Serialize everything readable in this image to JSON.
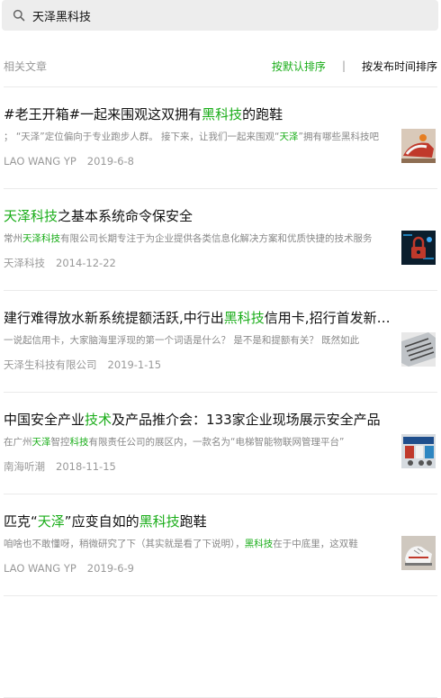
{
  "search": {
    "query": "天泽黑科技",
    "icon": "search-icon"
  },
  "section": {
    "label": "相关文章"
  },
  "sort": {
    "default_label": "按默认排序",
    "separator": "|",
    "time_label": "按发布时间排序"
  },
  "colors": {
    "highlight": "#1aad19",
    "muted": "#999999",
    "search_bg": "#ededed"
  },
  "results": [
    {
      "title": [
        {
          "t": "#老王开箱#一起来围观这双拥有"
        },
        {
          "t": "黑科技",
          "hl": true
        },
        {
          "t": "的跑鞋"
        }
      ],
      "snippet": [
        {
          "t": "；  “天泽”定位偏向于专业跑步人群。 接下来，让我们一起来围观“"
        },
        {
          "t": "天泽",
          "hl": true
        },
        {
          "t": "”拥有哪些黑科技吧"
        }
      ],
      "source": "LAO WANG YP",
      "date": "2019-6-8",
      "thumb": "shoe-colorful-thumbnail"
    },
    {
      "title": [
        {
          "t": "天泽科技",
          "hl": true
        },
        {
          "t": "之基本系统命令保安全"
        }
      ],
      "snippet": [
        {
          "t": "常州"
        },
        {
          "t": "天泽科技",
          "hl": true
        },
        {
          "t": "有限公司长期专注于为企业提供各类信息化解决方案和优质快捷的技术服务"
        }
      ],
      "source": "天泽科技",
      "date": "2014-12-22",
      "thumb": "security-lock-thumbnail"
    },
    {
      "title": [
        {
          "t": "建行难得放水新系统提额活跃,中行出"
        },
        {
          "t": "黑科技",
          "hl": true
        },
        {
          "t": "信用卡,招行首发新卡片"
        }
      ],
      "snippet": [
        {
          "t": "一说起信用卡，大家脑海里浮现的第一个词语是什么？ 是不是和提额有关？ 既然如此"
        }
      ],
      "source": "天泽生科技有限公司",
      "date": "2019-1-15",
      "thumb": "laptop-keyboard-thumbnail"
    },
    {
      "title": [
        {
          "t": "中国安全产业"
        },
        {
          "t": "技术",
          "hl": true
        },
        {
          "t": "及产品推介会：133家企业现场展示安全产品"
        }
      ],
      "snippet": [
        {
          "t": "在广州"
        },
        {
          "t": "天泽",
          "hl": true
        },
        {
          "t": "智控"
        },
        {
          "t": "科技",
          "hl": true
        },
        {
          "t": "有限责任公司的展区内，一款名为“电梯智能物联网管理平台”"
        }
      ],
      "source": "南海听潮",
      "date": "2018-11-15",
      "thumb": "exhibition-thumbnail"
    },
    {
      "title": [
        {
          "t": "匹克“"
        },
        {
          "t": "天泽",
          "hl": true
        },
        {
          "t": "”应变自如的"
        },
        {
          "t": "黑科技",
          "hl": true
        },
        {
          "t": "跑鞋"
        }
      ],
      "snippet": [
        {
          "t": "咱啥也不敢懂呀，稍微研究了下（其实就是看了下说明），"
        },
        {
          "t": "黑科技",
          "hl": true
        },
        {
          "t": "在于中底里，这双鞋"
        }
      ],
      "source": "LAO WANG YP",
      "date": "2019-6-9",
      "thumb": "shoe-white-thumbnail"
    }
  ]
}
